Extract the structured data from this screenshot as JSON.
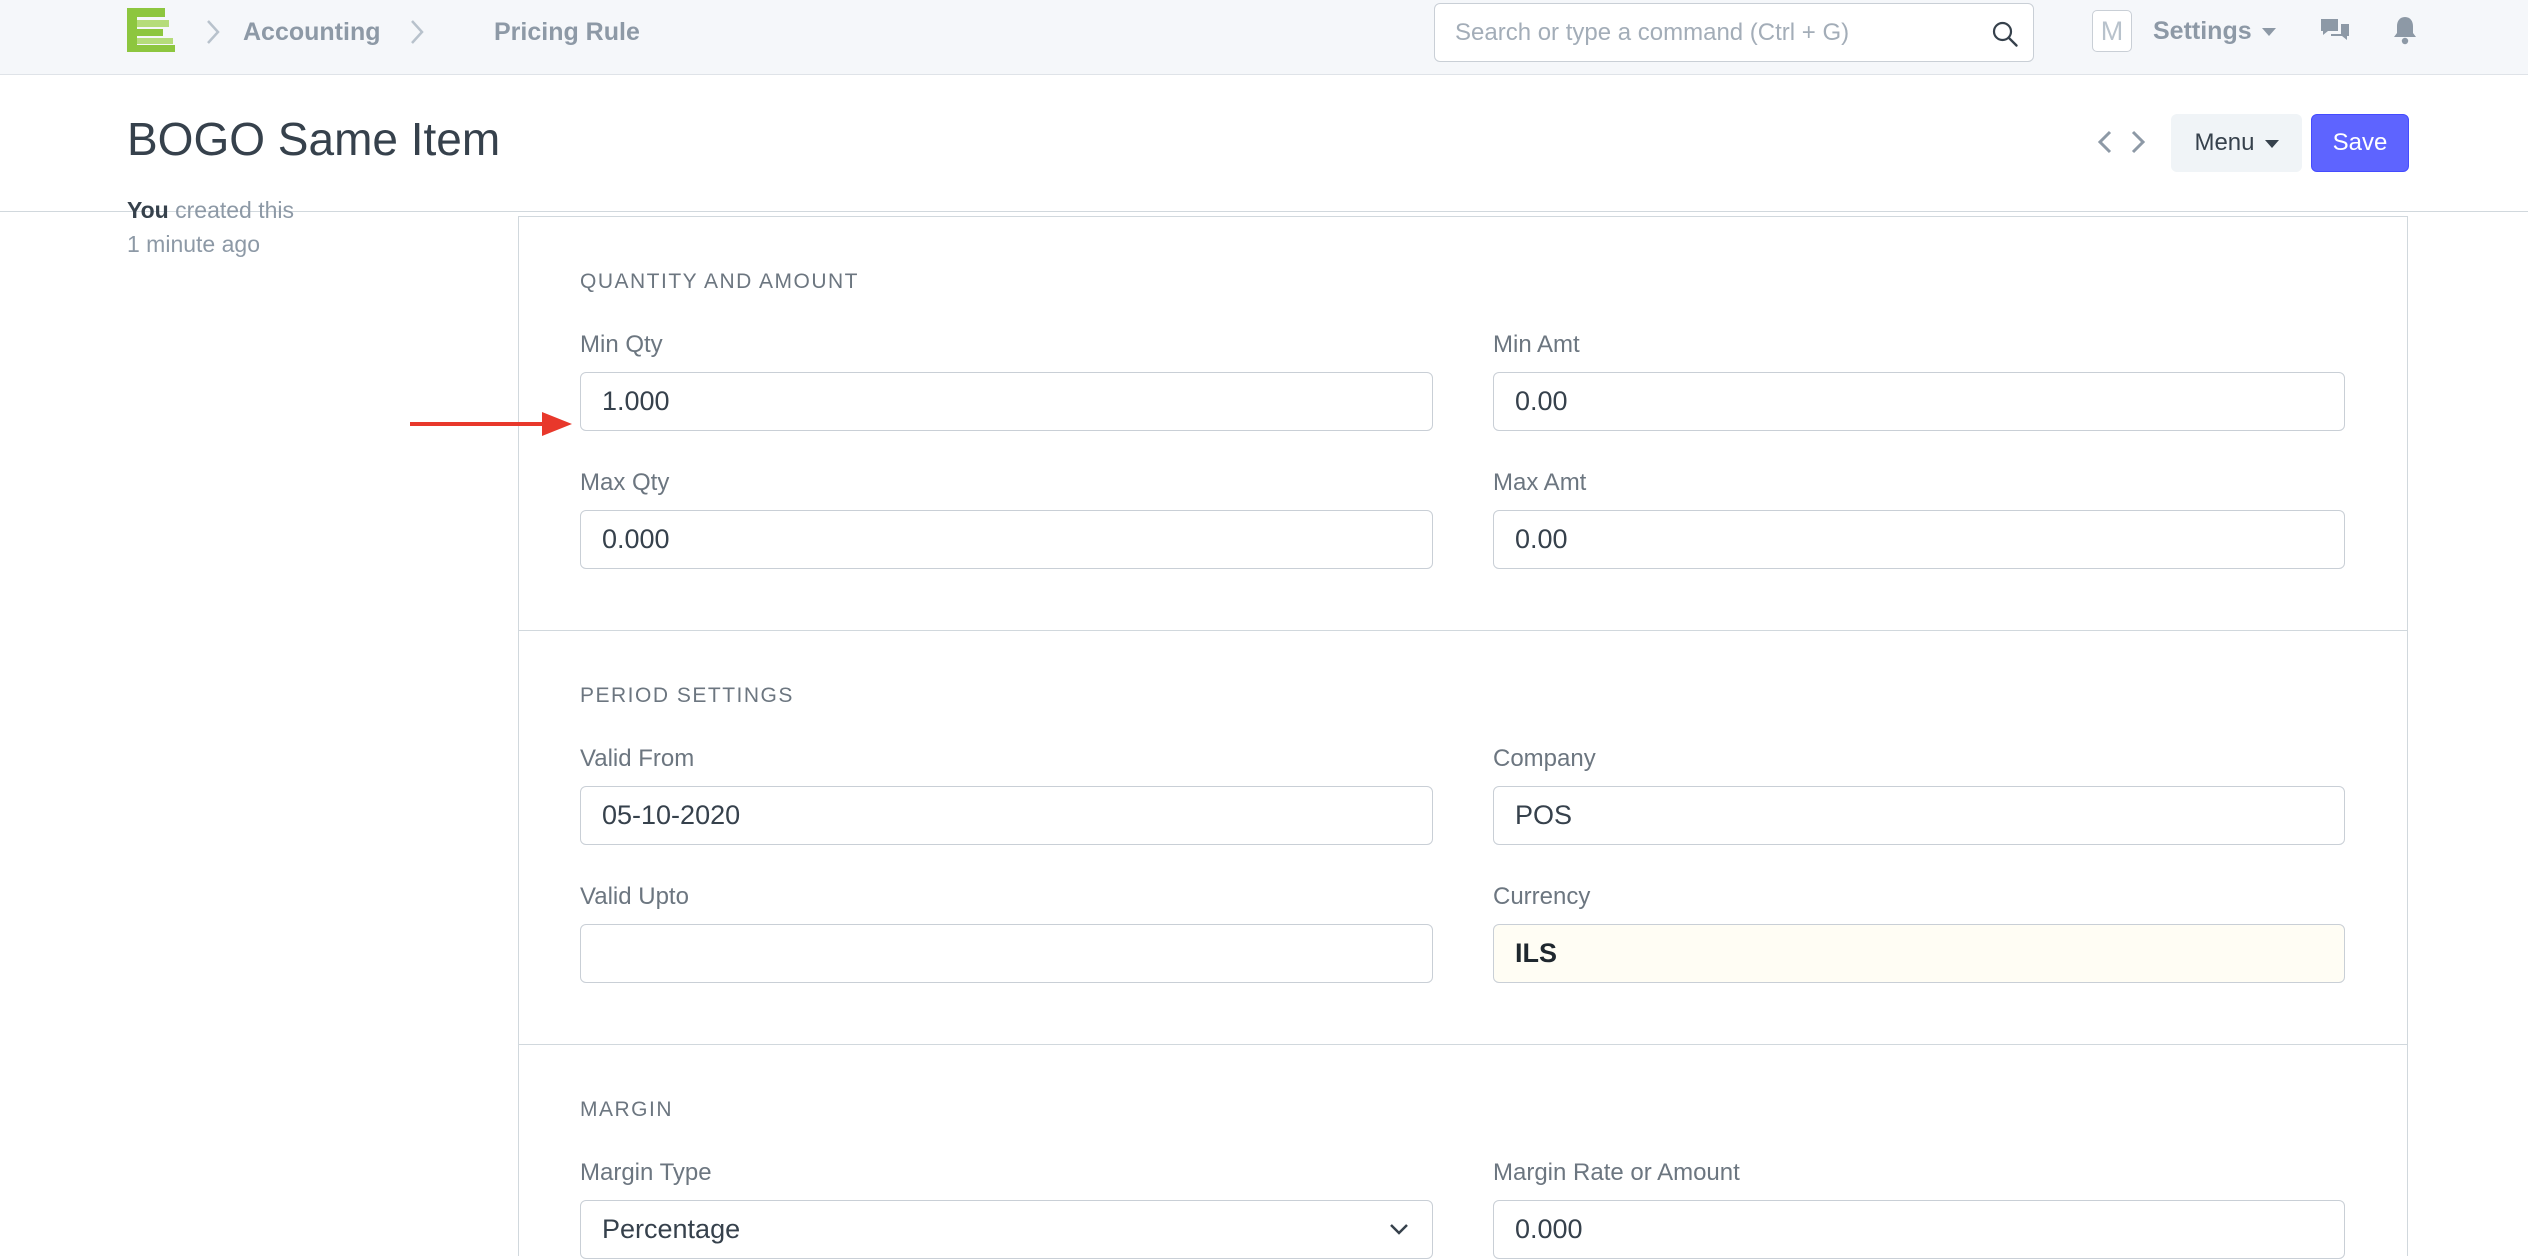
{
  "navbar": {
    "breadcrumbs": [
      "Accounting",
      "Pricing Rule"
    ],
    "search_placeholder": "Search or type a command (Ctrl + G)",
    "avatar_letter": "M",
    "settings_label": "Settings"
  },
  "page": {
    "title": "BOGO Same Item",
    "menu_label": "Menu",
    "save_label": "Save"
  },
  "sidebar": {
    "created_by": "You",
    "created_text": "created this",
    "created_time": "1 minute ago"
  },
  "sections": {
    "quantity": {
      "heading": "Quantity and Amount",
      "min_qty_label": "Min Qty",
      "min_qty_value": "1.000",
      "min_amt_label": "Min Amt",
      "min_amt_value": "0.00",
      "max_qty_label": "Max Qty",
      "max_qty_value": "0.000",
      "max_amt_label": "Max Amt",
      "max_amt_value": "0.00"
    },
    "period": {
      "heading": "Period Settings",
      "valid_from_label": "Valid From",
      "valid_from_value": "05-10-2020",
      "company_label": "Company",
      "company_value": "POS",
      "valid_upto_label": "Valid Upto",
      "valid_upto_value": "",
      "currency_label": "Currency",
      "currency_value": "ILS"
    },
    "margin": {
      "heading": "Margin",
      "margin_type_label": "Margin Type",
      "margin_type_value": "Percentage",
      "margin_rate_label": "Margin Rate or Amount",
      "margin_rate_value": "0.000"
    }
  },
  "colors": {
    "primary": "#5e64ff",
    "logo_green": "#8dc63f",
    "annotation_arrow": "#e8382b"
  }
}
